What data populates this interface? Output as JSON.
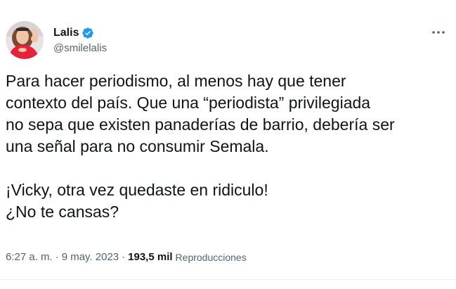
{
  "author": {
    "display_name": "Lalis",
    "handle": "@smilelalis",
    "verified": true
  },
  "more_icon": "ellipsis-icon",
  "tweet": {
    "paragraphs": [
      "Para hacer periodismo, al menos hay que tener\ncontexto del país. Que una “periodista” privilegiada\nno sepa que existen panaderías de barrio, debería ser\nuna señal para no consumir Semala.",
      "¡Vicky, otra vez quedaste en ridiculo!\n¿No te cansas?"
    ]
  },
  "meta": {
    "time": "6:27 a. m.",
    "separator": "·",
    "date": "9 may. 2023",
    "views_count": "193,5 mil",
    "views_label": "Reproducciones"
  },
  "colors": {
    "text_primary": "#0f1419",
    "text_secondary": "#536471",
    "verified_blue": "#1d9bf0",
    "divider": "#eff3f4"
  }
}
